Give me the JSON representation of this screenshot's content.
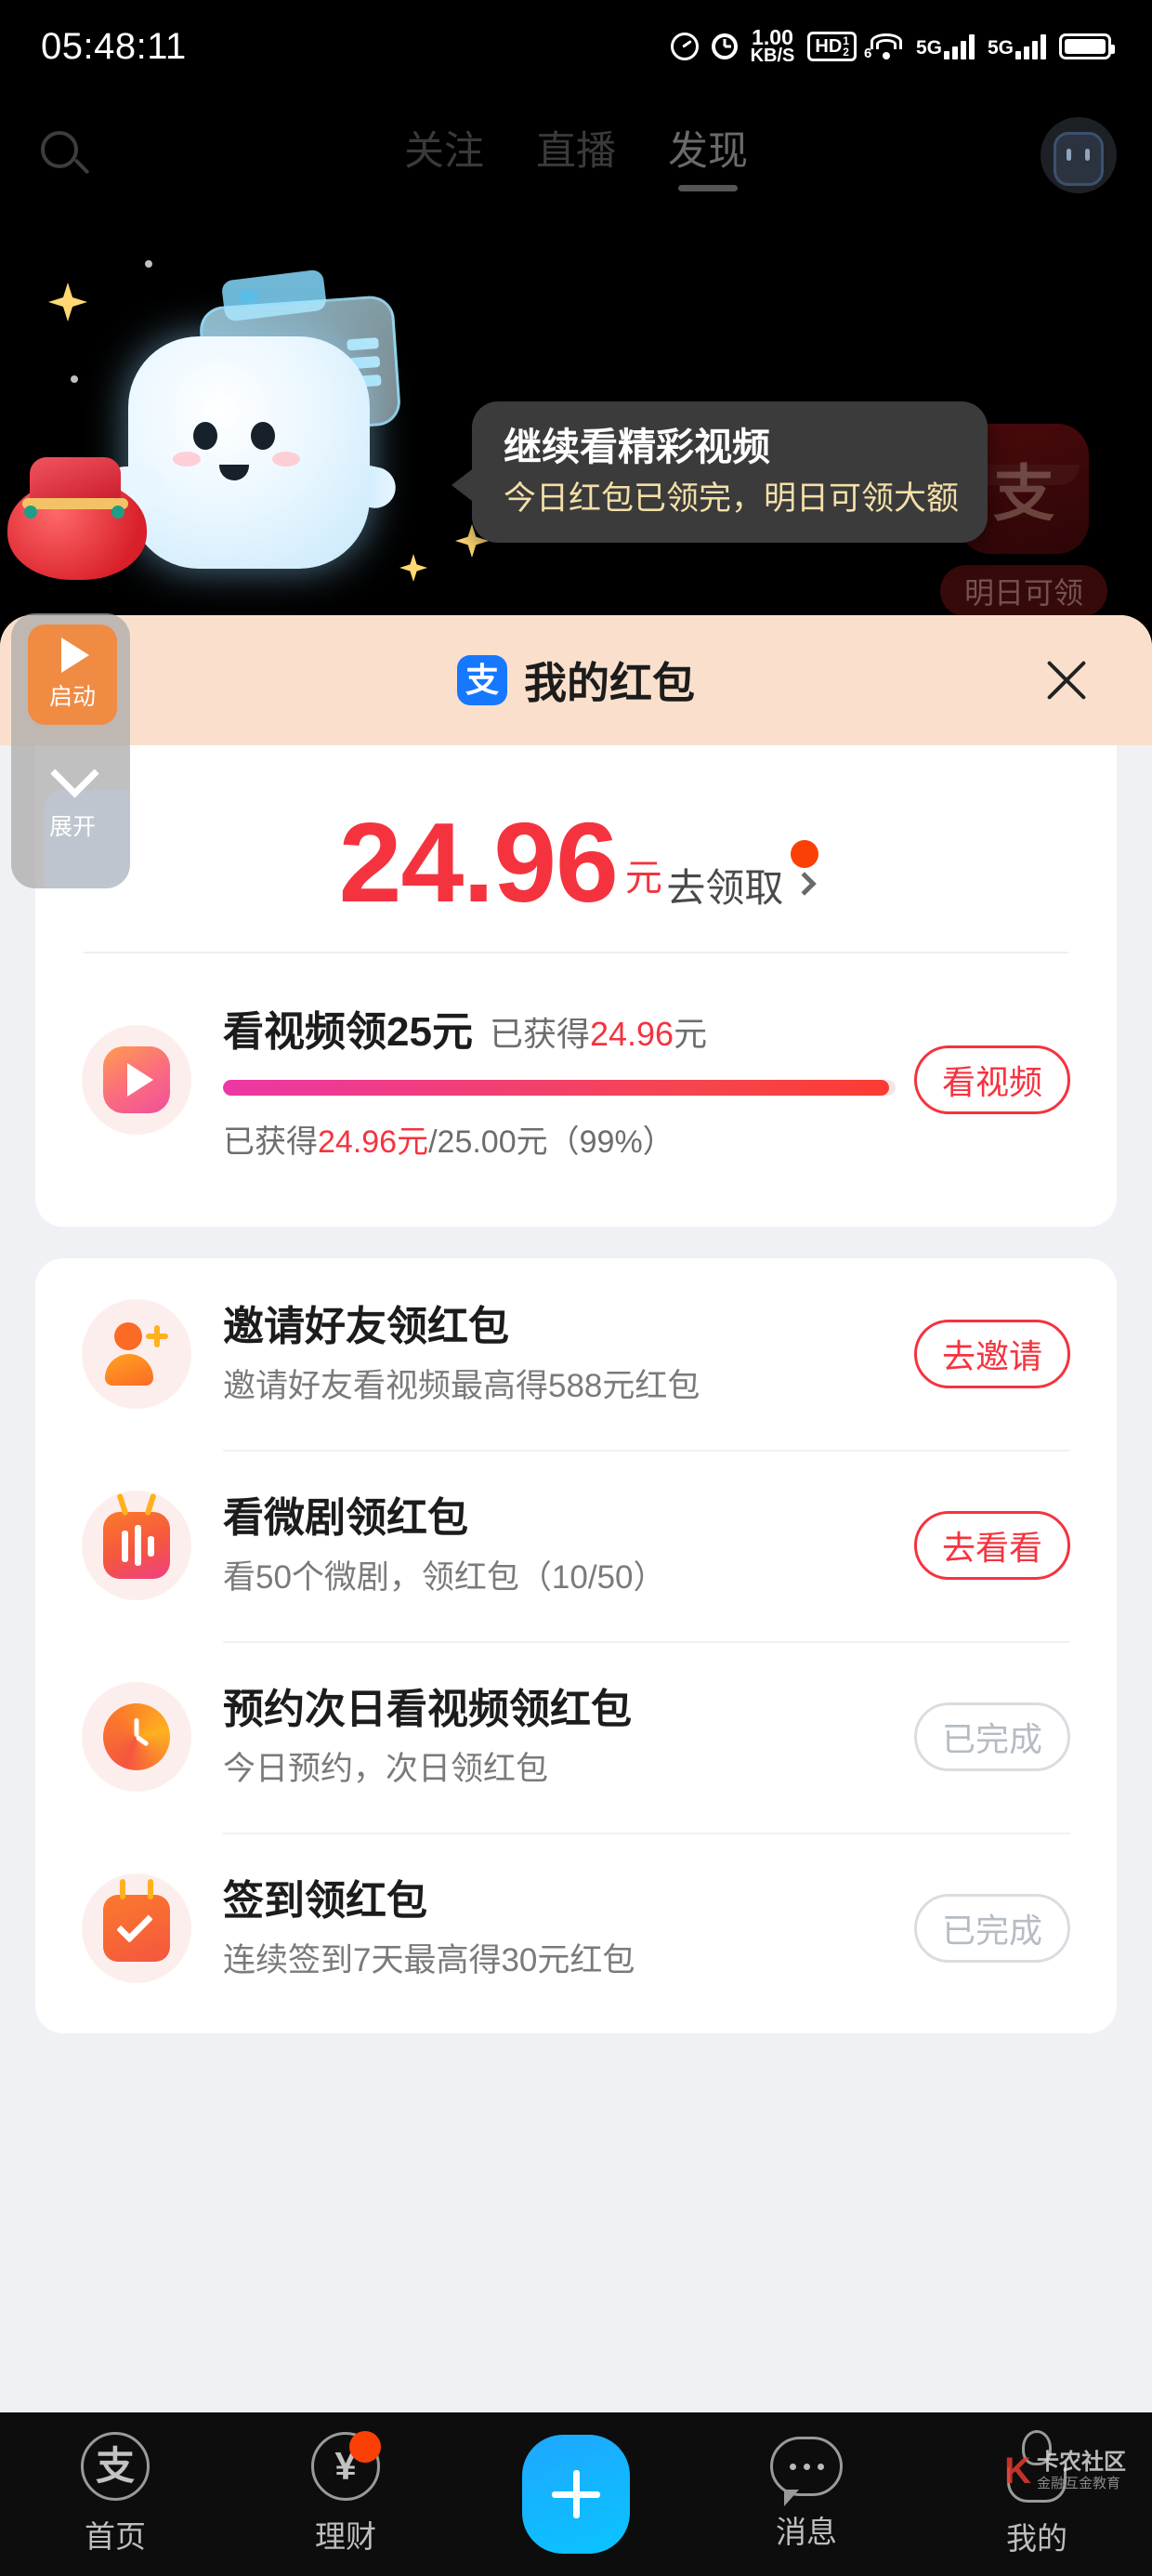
{
  "status_bar": {
    "time": "05:48:11",
    "net_speed_value": "1.00",
    "net_speed_unit": "KB/S",
    "hd_label": "HD",
    "hd_sup": "1",
    "hd_sub": "2",
    "wifi_gen": "6",
    "sim1_net": "5G",
    "sim2_net": "5G",
    "icons": [
      "speedometer-icon",
      "alarm-icon",
      "hd-icon",
      "wifi-icon",
      "signal-icon",
      "signal-icon",
      "battery-icon"
    ]
  },
  "top_nav": {
    "search_icon": "search-icon",
    "avatar": "avatar",
    "tabs": [
      {
        "label": "关注",
        "active": false
      },
      {
        "label": "直播",
        "active": false
      },
      {
        "label": "发现",
        "active": true
      }
    ]
  },
  "hero": {
    "redpacket_icon_glyph": "支",
    "redpacket_label": "明日可领"
  },
  "float_widget": {
    "start_label": "启动",
    "expand_label": "展开"
  },
  "tooltip": {
    "title": "继续看精彩视频",
    "subtitle": "今日红包已领完，明日可领大额"
  },
  "sheet": {
    "brand_glyph": "支",
    "title": "我的红包",
    "close_icon": "close-icon",
    "balance": {
      "amount": "24.96",
      "unit": "元",
      "claim_label": "去领取",
      "has_badge": true
    },
    "video_task": {
      "title": "看视频领25元",
      "earned_prefix": "已获得",
      "earned_amount": "24.96",
      "earned_suffix": "元",
      "progress_percent": 99,
      "progress_text_prefix": "已获得",
      "progress_earned": "24.96元",
      "progress_total": "/25.00元",
      "progress_percent_text": "（99%）",
      "button": "看视频",
      "icon": "play-video-icon"
    },
    "tasks": [
      {
        "icon": "invite-friend-icon",
        "title": "邀请好友领红包",
        "subtitle": "邀请好友看视频最高得588元红包",
        "button": "去邀请",
        "done": false
      },
      {
        "icon": "short-drama-icon",
        "title": "看微剧领红包",
        "subtitle": "看50个微剧，领红包（10/50）",
        "button": "去看看",
        "done": false
      },
      {
        "icon": "clock-icon",
        "title": "预约次日看视频领红包",
        "subtitle": "今日预约，次日领红包",
        "button": "已完成",
        "done": true
      },
      {
        "icon": "calendar-check-icon",
        "title": "签到领红包",
        "subtitle": "连续签到7天最高得30元红包",
        "button": "已完成",
        "done": true
      }
    ]
  },
  "bottom_nav": {
    "items": [
      {
        "label": "首页",
        "icon": "alipay-home-icon",
        "glyph": "支",
        "badge": false
      },
      {
        "label": "理财",
        "icon": "yuan-finance-icon",
        "glyph": "¥",
        "badge": true
      },
      {
        "label": "",
        "icon": "plus-icon",
        "glyph": "+",
        "badge": false
      },
      {
        "label": "消息",
        "icon": "message-icon",
        "glyph": "",
        "badge": false
      },
      {
        "label": "我的",
        "icon": "profile-icon",
        "glyph": "",
        "badge": false
      }
    ]
  },
  "watermark": {
    "mark": "K",
    "name": "卡农社区",
    "tagline": "金融互金教育"
  },
  "colors": {
    "accent_red": "#f5333f",
    "brand_blue": "#1678ff",
    "badge_orange": "#fb4006",
    "sheet_header": "#fae0cc",
    "sheet_bg": "#eff1f5"
  }
}
